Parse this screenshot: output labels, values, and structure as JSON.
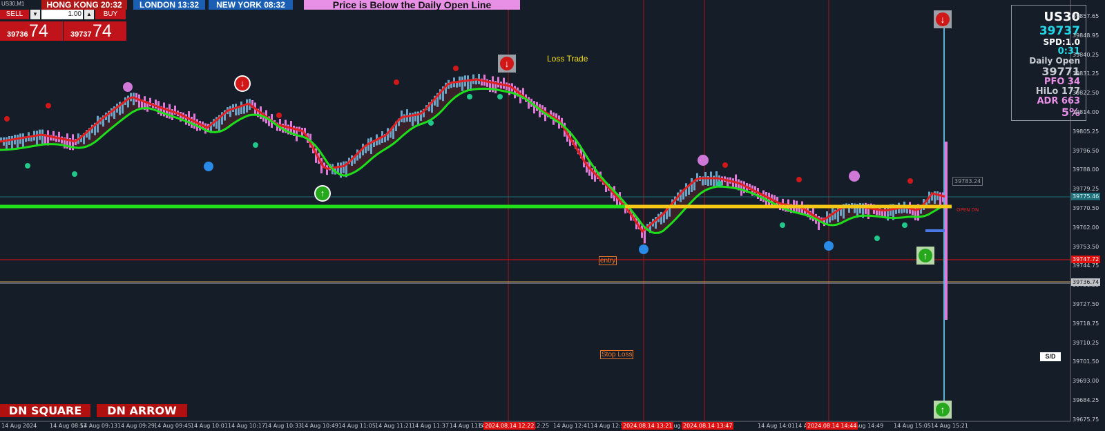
{
  "window": {
    "symbol_label": "US30,M1"
  },
  "sessions": [
    {
      "label": "HONG KONG 20:32",
      "color": "#b01818"
    },
    {
      "label": "LONDON  13:32",
      "color": "#1a5fb4"
    },
    {
      "label": "NEW YORK  08:32",
      "color": "#1a5fb4"
    }
  ],
  "alert_banner": "Price is Below the Daily Open Line",
  "trade_panel": {
    "sell_label": "SELL",
    "buy_label": "BUY",
    "lot_value": "1.00",
    "bid_small": "39736",
    "bid_big": "74",
    "ask_small": "39737",
    "ask_big": "74"
  },
  "info_panel": {
    "symbol": "US30",
    "price": "39737",
    "spread": "SPD:1.0",
    "timer": "0:31",
    "daily_open_label": "Daily Open",
    "daily_open_value": "39771",
    "pfo": "PFO  34",
    "hilo": "HiLo 177",
    "adr": "ADR 663",
    "pct": "5%"
  },
  "annotations": {
    "loss_trade": "Loss Trade",
    "entry": "entry",
    "stop_loss": "Stop Loss",
    "open_dn": "OPEN DN",
    "sd": "S/D"
  },
  "buttons": {
    "dn_square": "DN SQUARE",
    "dn_arrow": "DN ARROW"
  },
  "price_axis": [
    "39857.65",
    "39848.95",
    "39840.25",
    "39831.25",
    "39822.50",
    "39814.00",
    "39805.25",
    "39796.50",
    "39788.00",
    "39779.25",
    "39770.50",
    "39762.00",
    "39753.50",
    "39744.75",
    "39736.25",
    "39727.50",
    "39718.75",
    "39710.25",
    "39701.50",
    "39693.00",
    "39684.25",
    "39675.75"
  ],
  "price_tags": [
    {
      "label": "39783.24",
      "bg": "#151d29",
      "fg": "#9aa0a6"
    },
    {
      "label": "39775.46",
      "bg": "#1f6f7a",
      "fg": "#d8f4f6"
    },
    {
      "label": "39747.72",
      "bg": "#e01010",
      "fg": "#ffffff"
    },
    {
      "label": "39736.74",
      "bg": "#c0c4c8",
      "fg": "#202020"
    }
  ],
  "time_axis": [
    "14 Aug 2024",
    "14 Aug 08:57",
    "14 Aug 09:13",
    "14 Aug 09:29",
    "14 Aug 09:45",
    "14 Aug 10:01",
    "14 Aug 10:17",
    "14 Aug 10:33",
    "14 Aug 10:49",
    "14 Aug 11:05",
    "14 Aug 11:21",
    "14 Aug 11:37",
    "14 Aug 11:53",
    "14",
    "12:25",
    "14 Aug 12:41",
    "14 Aug 12:57",
    "Aug",
    "5",
    "14 Aug 14:01",
    "14 Aug 14:17",
    "Aug 14:49",
    "14 Aug 15:05",
    "14 Aug 15:21"
  ],
  "time_highlights": [
    "2024.08.14 12:22",
    "2024.08.14 13:21",
    "2024.08.14 13:47",
    "2024.08.14 14:44"
  ],
  "colors": {
    "background": "#151d29",
    "daily_open_line": "#22e01a",
    "fast_ma": "#e02020",
    "slow_ma": "#1ee01a",
    "bull_bar": "#6aa5c8",
    "bear_bar": "#e07ad8"
  }
}
